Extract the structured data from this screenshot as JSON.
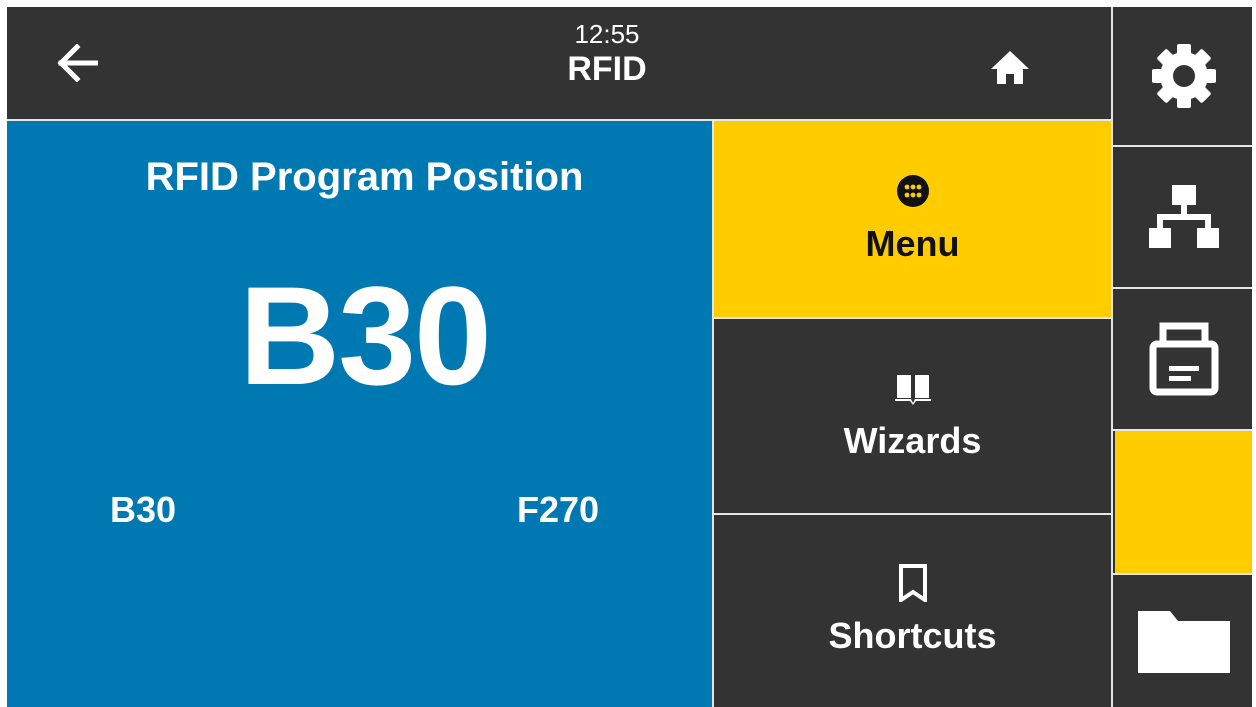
{
  "header": {
    "time": "12:55",
    "title": "RFID",
    "back_icon": "back-arrow-icon",
    "home_icon": "home-icon"
  },
  "setting": {
    "name": "RFID Program Position",
    "current_value": "B30",
    "range_min": "B30",
    "range_max": "F270"
  },
  "nav": [
    {
      "label": "Menu",
      "icon": "menu-grid-icon",
      "active": true
    },
    {
      "label": "Wizards",
      "icon": "book-icon",
      "active": false
    },
    {
      "label": "Shortcuts",
      "icon": "bookmark-icon",
      "active": false
    }
  ],
  "rail": [
    {
      "icon": "gear-icon"
    },
    {
      "icon": "network-icon"
    },
    {
      "icon": "printer-icon"
    },
    {
      "icon": "rfid-icon",
      "active": true
    },
    {
      "icon": "folder-icon"
    }
  ],
  "colors": {
    "background": "#333333",
    "panel_blue": "#0079b3",
    "accent_yellow": "#ffcc00",
    "divider": "#e6e6e6",
    "text_light": "#ffffff"
  }
}
